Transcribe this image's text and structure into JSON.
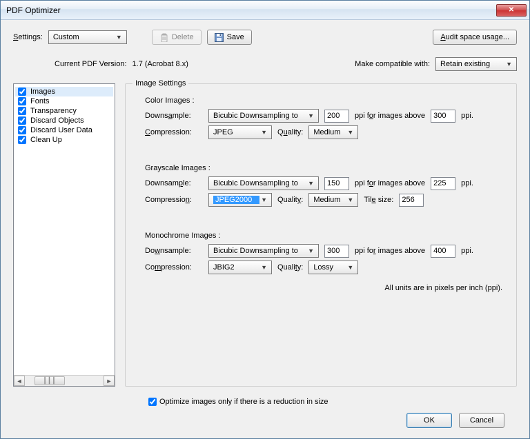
{
  "window": {
    "title": "PDF Optimizer"
  },
  "toolbar": {
    "settings_label": "Settings:",
    "settings_value": "Custom",
    "delete_label": "Delete",
    "save_label": "Save",
    "audit_label": "Audit space usage..."
  },
  "version": {
    "current_label": "Current PDF Version:",
    "current_value": "1.7 (Acrobat 8.x)",
    "compat_label": "Make compatible with:",
    "compat_value": "Retain existing"
  },
  "sidebar": {
    "items": [
      {
        "label": "Images",
        "checked": true,
        "selected": true
      },
      {
        "label": "Fonts",
        "checked": true,
        "selected": false
      },
      {
        "label": "Transparency",
        "checked": true,
        "selected": false
      },
      {
        "label": "Discard Objects",
        "checked": true,
        "selected": false
      },
      {
        "label": "Discard User Data",
        "checked": true,
        "selected": false
      },
      {
        "label": "Clean Up",
        "checked": true,
        "selected": false
      }
    ]
  },
  "panel": {
    "title": "Image Settings",
    "color": {
      "header": "Color Images :",
      "downsample_label": "Downsample:",
      "downsample_value": "Bicubic Downsampling to",
      "ppi": "200",
      "ppi_unit": "ppi for images above",
      "above": "300",
      "above_unit": "ppi.",
      "compression_label": "Compression:",
      "compression_value": "JPEG",
      "quality_label": "Quality:",
      "quality_value": "Medium"
    },
    "gray": {
      "header": "Grayscale Images :",
      "downsample_label": "Downsample:",
      "downsample_value": "Bicubic Downsampling to",
      "ppi": "150",
      "ppi_unit": "ppi for images above",
      "above": "225",
      "above_unit": "ppi.",
      "compression_label": "Compression:",
      "compression_value": "JPEG2000",
      "quality_label": "Quality:",
      "quality_value": "Medium",
      "tilesize_label": "Tile size:",
      "tilesize_value": "256"
    },
    "mono": {
      "header": "Monochrome Images :",
      "downsample_label": "Downsample:",
      "downsample_value": "Bicubic Downsampling to",
      "ppi": "300",
      "ppi_unit": "ppi for images above",
      "above": "400",
      "above_unit": "ppi.",
      "compression_label": "Compression:",
      "compression_value": "JBIG2",
      "quality_label": "Quality:",
      "quality_value": "Lossy"
    },
    "footnote": "All units are in pixels per inch (ppi).",
    "optimize_checkbox_label": "Optimize images only if there is a reduction in size",
    "optimize_checked": true
  },
  "footer": {
    "ok": "OK",
    "cancel": "Cancel"
  }
}
